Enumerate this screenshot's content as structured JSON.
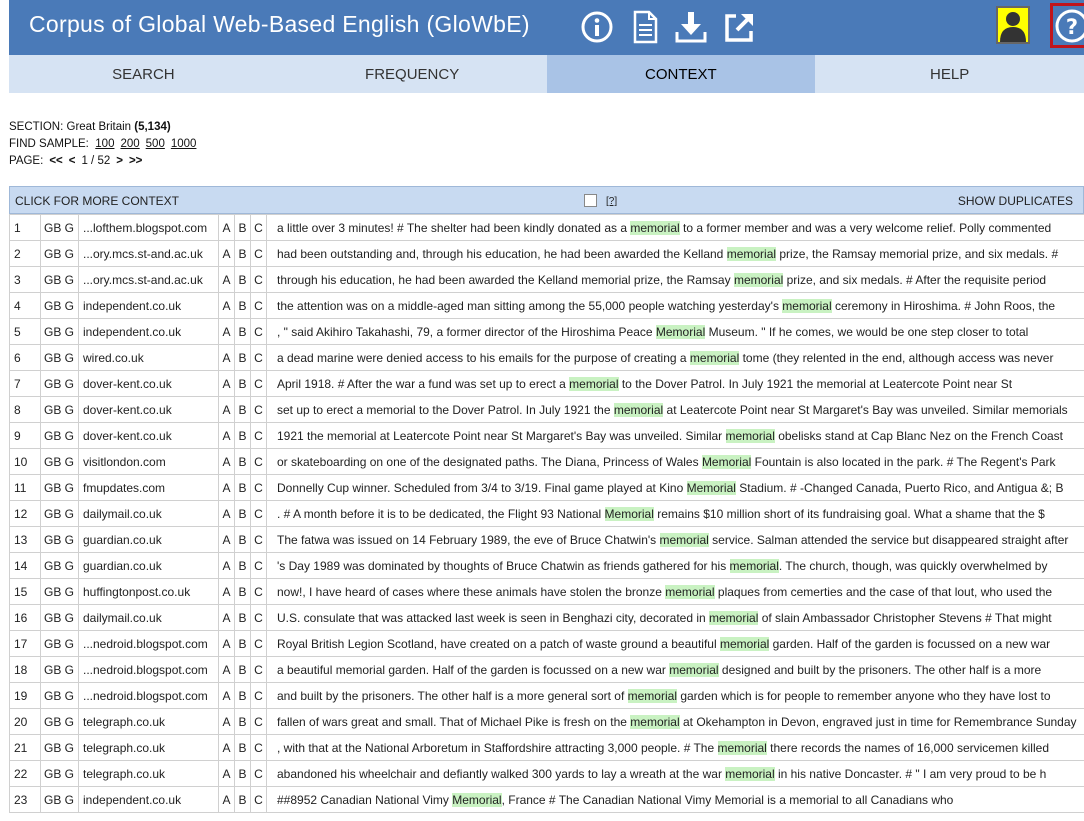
{
  "header": {
    "title": "Corpus of Global Web-Based English (GloWbE)",
    "icons": [
      "info-icon",
      "document-icon",
      "download-icon",
      "external-link-icon"
    ]
  },
  "nav": {
    "tabs": [
      "SEARCH",
      "FREQUENCY",
      "CONTEXT",
      "HELP"
    ],
    "active": "CONTEXT"
  },
  "info": {
    "section_label": "SECTION: Great Britain",
    "section_count": "(5,134)",
    "find_sample_label": "FIND SAMPLE:",
    "samples": [
      "100",
      "200",
      "500",
      "1000"
    ],
    "page_label": "PAGE:",
    "first": "<<",
    "prev": "<",
    "page": "1 / 52",
    "next": ">",
    "last": ">>"
  },
  "results": {
    "more_context": "CLICK FOR MORE CONTEXT",
    "help_mark": "[?]",
    "show_duplicates": "SHOW DUPLICATES",
    "rows": [
      {
        "n": "1",
        "g": "GB G",
        "src": "...lofthem.blogspot.com",
        "pre": "a little over 3 minutes! # The shelter had been kindly donated as a ",
        "kw": "memorial",
        "post": " to a former member and was a very welcome relief. Polly commented"
      },
      {
        "n": "2",
        "g": "GB G",
        "src": "...ory.mcs.st-and.ac.uk",
        "pre": "had been outstanding and, through his education, he had been awarded the Kelland ",
        "kw": "memorial",
        "post": " prize, the Ramsay memorial prize, and six medals. #"
      },
      {
        "n": "3",
        "g": "GB G",
        "src": "...ory.mcs.st-and.ac.uk",
        "pre": "through his education, he had been awarded the Kelland memorial prize, the Ramsay ",
        "kw": "memorial",
        "post": " prize, and six medals. # After the requisite period"
      },
      {
        "n": "4",
        "g": "GB G",
        "src": "independent.co.uk",
        "pre": "the attention was on a middle-aged man sitting among the 55,000 people watching yesterday's ",
        "kw": "memorial",
        "post": " ceremony in Hiroshima. # John Roos, the"
      },
      {
        "n": "5",
        "g": "GB G",
        "src": "independent.co.uk",
        "pre": ", \" said Akihiro Takahashi, 79, a former director of the Hiroshima Peace ",
        "kw": "Memorial",
        "post": " Museum. \" If he comes, we would be one step closer to total"
      },
      {
        "n": "6",
        "g": "GB G",
        "src": "wired.co.uk",
        "pre": "a dead marine were denied access to his emails for the purpose of creating a ",
        "kw": "memorial",
        "post": " tome (they relented in the end, although access was never"
      },
      {
        "n": "7",
        "g": "GB G",
        "src": "dover-kent.co.uk",
        "pre": "April 1918. # After the war a fund was set up to erect a ",
        "kw": "memorial",
        "post": " to the Dover Patrol. In July 1921 the memorial at Leatercote Point near St"
      },
      {
        "n": "8",
        "g": "GB G",
        "src": "dover-kent.co.uk",
        "pre": "set up to erect a memorial to the Dover Patrol. In July 1921 the ",
        "kw": "memorial",
        "post": " at Leatercote Point near St Margaret's Bay was unveiled. Similar memorials"
      },
      {
        "n": "9",
        "g": "GB G",
        "src": "dover-kent.co.uk",
        "pre": "1921 the memorial at Leatercote Point near St Margaret's Bay was unveiled. Similar ",
        "kw": "memorial",
        "post": " obelisks stand at Cap Blanc Nez on the French Coast"
      },
      {
        "n": "10",
        "g": "GB G",
        "src": "visitlondon.com",
        "pre": "or skateboarding on one of the designated paths. The Diana, Princess of Wales ",
        "kw": "Memorial",
        "post": " Fountain is also located in the park. # The Regent's Park"
      },
      {
        "n": "11",
        "g": "GB G",
        "src": "fmupdates.com",
        "pre": "Donnelly Cup winner. Scheduled from 3/4 to 3/19. Final game played at Kino ",
        "kw": "Memorial",
        "post": " Stadium. # -Changed Canada, Puerto Rico, and Antigua &; B"
      },
      {
        "n": "12",
        "g": "GB G",
        "src": "dailymail.co.uk",
        "pre": ". # A month before it is to be dedicated, the Flight 93 National ",
        "kw": "Memorial",
        "post": " remains $10 million short of its fundraising goal. What a shame that the $"
      },
      {
        "n": "13",
        "g": "GB G",
        "src": "guardian.co.uk",
        "pre": "The fatwa was issued on 14 February 1989, the eve of Bruce Chatwin's ",
        "kw": "memorial",
        "post": " service. Salman attended the service but disappeared straight after"
      },
      {
        "n": "14",
        "g": "GB G",
        "src": "guardian.co.uk",
        "pre": "'s Day 1989 was dominated by thoughts of Bruce Chatwin as friends gathered for his ",
        "kw": "memorial",
        "post": ". The church, though, was quickly overwhelmed by"
      },
      {
        "n": "15",
        "g": "GB G",
        "src": "huffingtonpost.co.uk",
        "pre": "now!, I have heard of cases where these animals have stolen the bronze ",
        "kw": "memorial",
        "post": " plaques from cemerties and the case of that lout, who used the"
      },
      {
        "n": "16",
        "g": "GB G",
        "src": "dailymail.co.uk",
        "pre": "U.S. consulate that was attacked last week is seen in Benghazi city, decorated in ",
        "kw": "memorial",
        "post": " of slain Ambassador Christopher Stevens # That might"
      },
      {
        "n": "17",
        "g": "GB G",
        "src": "...nedroid.blogspot.com",
        "pre": "Royal British Legion Scotland, have created on a patch of waste ground a beautiful ",
        "kw": "memorial",
        "post": " garden. Half of the garden is focussed on a new war"
      },
      {
        "n": "18",
        "g": "GB G",
        "src": "...nedroid.blogspot.com",
        "pre": "a beautiful memorial garden. Half of the garden is focussed on a new war ",
        "kw": "memorial",
        "post": " designed and built by the prisoners. The other half is a more"
      },
      {
        "n": "19",
        "g": "GB G",
        "src": "...nedroid.blogspot.com",
        "pre": "and built by the prisoners. The other half is a more general sort of ",
        "kw": "memorial",
        "post": " garden which is for people to remember anyone who they have lost to"
      },
      {
        "n": "20",
        "g": "GB G",
        "src": "telegraph.co.uk",
        "pre": "fallen of wars great and small. That of Michael Pike is fresh on the ",
        "kw": "memorial",
        "post": " at Okehampton in Devon, engraved just in time for Remembrance Sunday"
      },
      {
        "n": "21",
        "g": "GB G",
        "src": "telegraph.co.uk",
        "pre": ", with that at the National Arboretum in Staffordshire attracting 3,000 people. # The ",
        "kw": "memorial",
        "post": " there records the names of 16,000 servicemen killed"
      },
      {
        "n": "22",
        "g": "GB G",
        "src": "telegraph.co.uk",
        "pre": "abandoned his wheelchair and defiantly walked 300 yards to lay a wreath at the war ",
        "kw": "memorial",
        "post": " in his native Doncaster. # \" I am very proud to be h"
      },
      {
        "n": "23",
        "g": "GB G",
        "src": "independent.co.uk",
        "pre": "##8952 Canadian National Vimy ",
        "kw": "Memorial",
        "post": ", France # The Canadian National Vimy Memorial is a memorial to all Canadians who"
      }
    ]
  }
}
